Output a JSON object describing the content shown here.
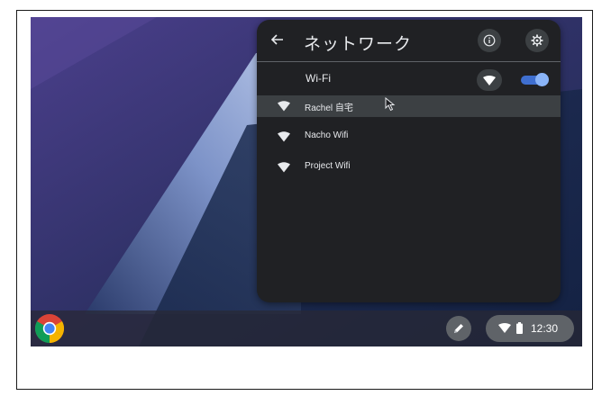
{
  "network_panel": {
    "title": "ネットワーク",
    "wifi": {
      "label": "Wi-Fi",
      "enabled": true
    },
    "networks": [
      {
        "name": "Rachel 自宅",
        "hovered": true
      },
      {
        "name": "Nacho Wifi",
        "hovered": false
      },
      {
        "name": "Project Wifi",
        "hovered": false
      }
    ]
  },
  "shelf": {
    "time": "12:30"
  },
  "icons": {
    "back": "back-arrow-icon",
    "info": "info-icon",
    "settings": "gear-icon",
    "wifi": "wifi-icon",
    "toggle": "toggle-switch",
    "cursor": "mouse-cursor-icon",
    "launcher": "chrome-logo-icon",
    "stylus": "stylus-icon",
    "battery": "battery-icon"
  },
  "colors": {
    "panel_bg": "#202124",
    "accent": "#8ab4f8",
    "toggle_track": "#3f6fd0",
    "shelf_pill": "#5f6368"
  }
}
